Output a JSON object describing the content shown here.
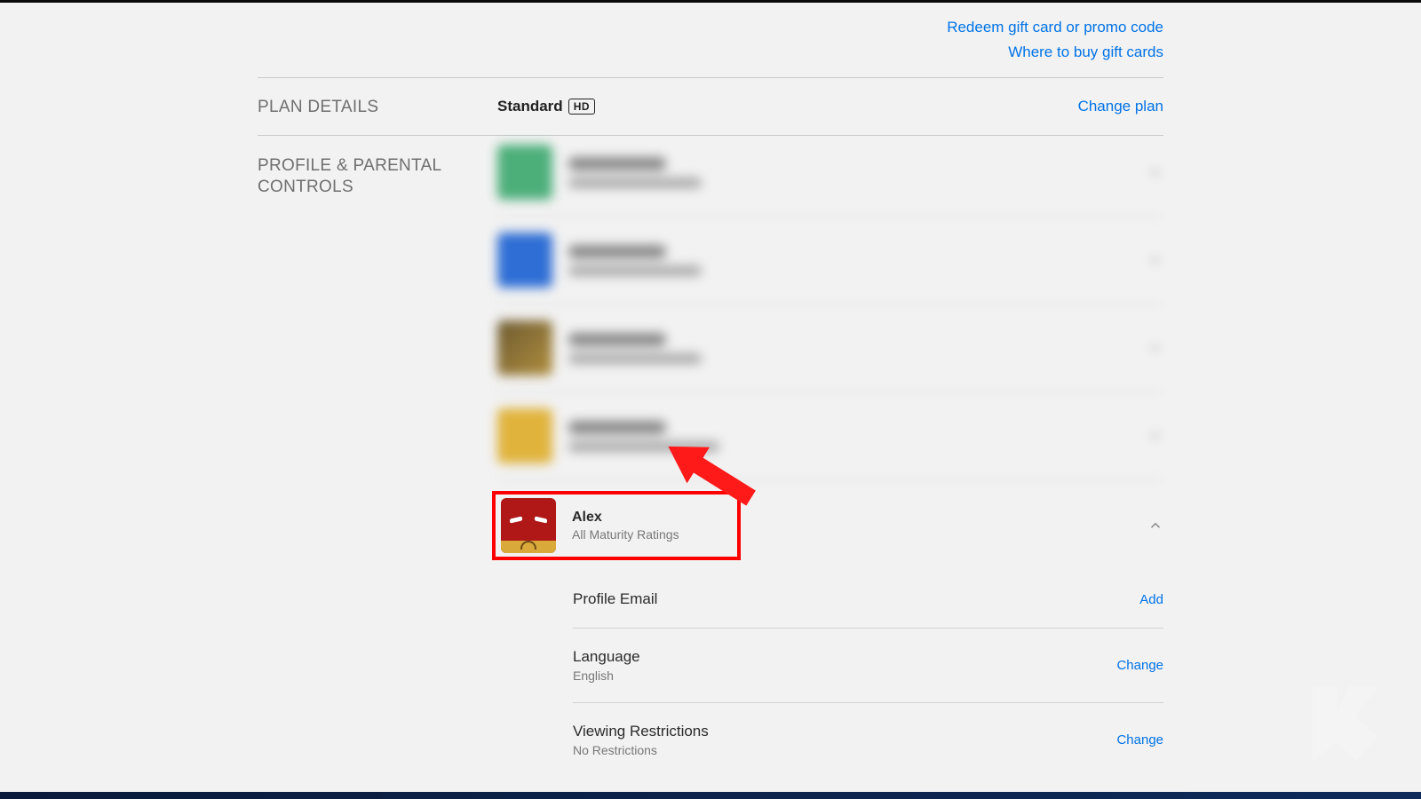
{
  "links": {
    "redeem": "Redeem gift card or promo code",
    "where_buy": "Where to buy gift cards"
  },
  "plan": {
    "section_label": "PLAN DETAILS",
    "name": "Standard",
    "badge": "HD",
    "change": "Change plan"
  },
  "profiles_section": {
    "label": "PROFILE & PARENTAL CONTROLS"
  },
  "blurred_profiles": [
    {
      "avatar_color": "#4caf7a"
    },
    {
      "avatar_color": "#2f6ed5"
    },
    {
      "avatar_color": "#b08e3f"
    },
    {
      "avatar_color": "#e0b33c"
    }
  ],
  "active_profile": {
    "name": "Alex",
    "subtitle": "All Maturity Ratings"
  },
  "details": {
    "profile_email": {
      "title": "Profile Email",
      "action": "Add"
    },
    "language": {
      "title": "Language",
      "value": "English",
      "action": "Change"
    },
    "viewing": {
      "title": "Viewing Restrictions",
      "value": "No Restrictions",
      "action": "Change"
    }
  }
}
